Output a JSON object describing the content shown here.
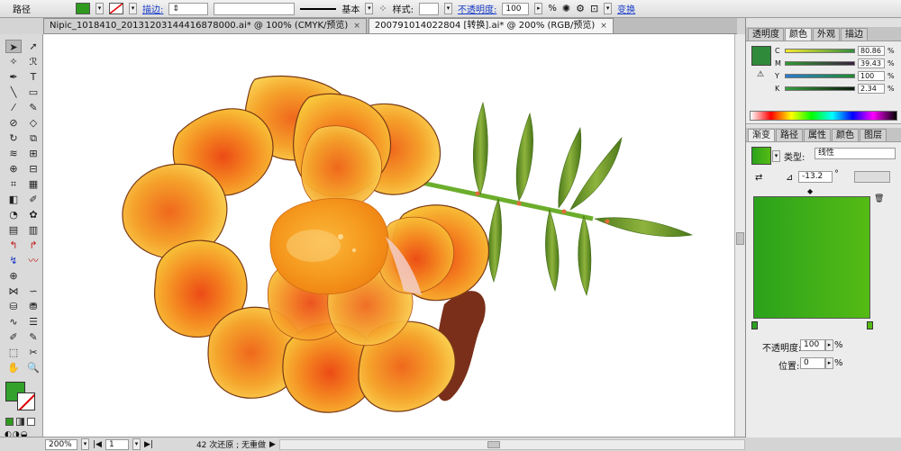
{
  "control_bar": {
    "object_type": "路径",
    "stroke_label": "描边:",
    "brush_label": "基本",
    "style_label": "样式:",
    "opacity_label": "不透明度:",
    "opacity_value": "100",
    "opacity_unit": "%",
    "transform_label": "变换",
    "fill_color": "#2f9a1e"
  },
  "tabs": [
    {
      "label": "Nipic_1018410_20131203144416878000.ai* @ 100% (CMYK/预览)",
      "close": "×"
    },
    {
      "label": "2007910140228​04 [转换].ai* @ 200% (RGB/预览)",
      "close": "×"
    }
  ],
  "tools": [
    {
      "glyph": "➤",
      "name": "selection-tool-icon"
    },
    {
      "glyph": "➚",
      "name": "direct-selection-tool-icon"
    },
    {
      "glyph": "✧",
      "name": "magic-wand-tool-icon"
    },
    {
      "glyph": "ℛ",
      "name": "lasso-tool-icon"
    },
    {
      "glyph": "✒",
      "name": "pen-tool-icon"
    },
    {
      "glyph": "T",
      "name": "type-tool-icon"
    },
    {
      "glyph": "╲",
      "name": "line-tool-icon"
    },
    {
      "glyph": "▭",
      "name": "rectangle-tool-icon"
    },
    {
      "glyph": "⁄",
      "name": "paintbrush-tool-icon"
    },
    {
      "glyph": "✎",
      "name": "pencil-tool-icon"
    },
    {
      "glyph": "⊘",
      "name": "blob-brush-tool-icon"
    },
    {
      "glyph": "◇",
      "name": "eraser-tool-icon"
    },
    {
      "glyph": "↻",
      "name": "rotate-tool-icon"
    },
    {
      "glyph": "⧉",
      "name": "scale-tool-icon"
    },
    {
      "glyph": "≋",
      "name": "width-tool-icon"
    },
    {
      "glyph": "⊞",
      "name": "free-transform-tool-icon"
    },
    {
      "glyph": "⊕",
      "name": "shape-builder-tool-icon"
    },
    {
      "glyph": "⊟",
      "name": "live-paint-tool-icon"
    },
    {
      "glyph": "⌗",
      "name": "perspective-grid-tool-icon"
    },
    {
      "glyph": "▦",
      "name": "mesh-tool-icon"
    },
    {
      "glyph": "◧",
      "name": "gradient-tool-icon"
    },
    {
      "glyph": "✐",
      "name": "eyedropper-tool-icon"
    },
    {
      "glyph": "◔",
      "name": "blend-tool-icon"
    },
    {
      "glyph": "✿",
      "name": "symbol-sprayer-tool-icon"
    },
    {
      "glyph": "▤",
      "name": "column-graph-tool-icon"
    },
    {
      "glyph": "▥",
      "name": "bar-graph-tool-icon"
    },
    {
      "glyph": "↰",
      "name": "custom-red-tool-1-icon",
      "style": "red"
    },
    {
      "glyph": "↱",
      "name": "custom-red-tool-2-icon",
      "style": "red"
    },
    {
      "glyph": "↯",
      "name": "custom-blue-tool-icon",
      "style": "blue"
    },
    {
      "glyph": "〰",
      "name": "custom-red-tool-3-icon",
      "style": "red"
    },
    {
      "glyph": "⊕",
      "name": "target-tool-icon"
    },
    {
      "glyph": "",
      "name": "empty-slot"
    },
    {
      "glyph": "⋈",
      "name": "envelope-tool-1-icon"
    },
    {
      "glyph": "∽",
      "name": "envelope-tool-2-icon"
    },
    {
      "glyph": "⛁",
      "name": "stamp-tool-1-icon"
    },
    {
      "glyph": "⛃",
      "name": "stamp-tool-2-icon"
    },
    {
      "glyph": "∿",
      "name": "wave-tool-icon"
    },
    {
      "glyph": "☰",
      "name": "align-tool-icon"
    },
    {
      "glyph": "✐",
      "name": "eyedropper-2-tool-icon"
    },
    {
      "glyph": "✎",
      "name": "pencil-2-tool-icon"
    },
    {
      "glyph": "⬚",
      "name": "artboard-tool-icon"
    },
    {
      "glyph": "✂",
      "name": "slice-tool-icon"
    },
    {
      "glyph": "✋",
      "name": "hand-tool-icon"
    },
    {
      "glyph": "🔍",
      "name": "zoom-tool-icon"
    }
  ],
  "color_panel": {
    "tabs": [
      "透明度",
      "颜色",
      "外观",
      "描边"
    ],
    "active_tab": 1,
    "swatch": "#2f8a3a",
    "channels": [
      {
        "label": "C",
        "value": "80.86",
        "gradient": "linear-gradient(90deg,#f7ea2c,#2f8e3a)"
      },
      {
        "label": "M",
        "value": "39.43",
        "gradient": "linear-gradient(90deg,#2f9a2f,#3a2040)"
      },
      {
        "label": "Y",
        "value": "100",
        "gradient": "linear-gradient(90deg,#2a7bd0,#1e8a2e)"
      },
      {
        "label": "K",
        "value": "2.34",
        "gradient": "linear-gradient(90deg,#37a03c,#0d1a0d)"
      }
    ],
    "percent": "%"
  },
  "gradient_panel": {
    "tabs": [
      "渐变",
      "路径",
      "属性",
      "颜色",
      "图层"
    ],
    "active_tab": 0,
    "type_label": "类型:",
    "type_value": "线性",
    "angle_value": "-13.2",
    "angle_unit": "°",
    "opacity_label": "不透明度:",
    "opacity_value": "100",
    "location_label": "位置:",
    "location_value": "0",
    "percent": "%"
  },
  "status": {
    "zoom": "200%",
    "artboard": "1",
    "history": "42 次还原 ; 无重做",
    "play": "▶"
  }
}
